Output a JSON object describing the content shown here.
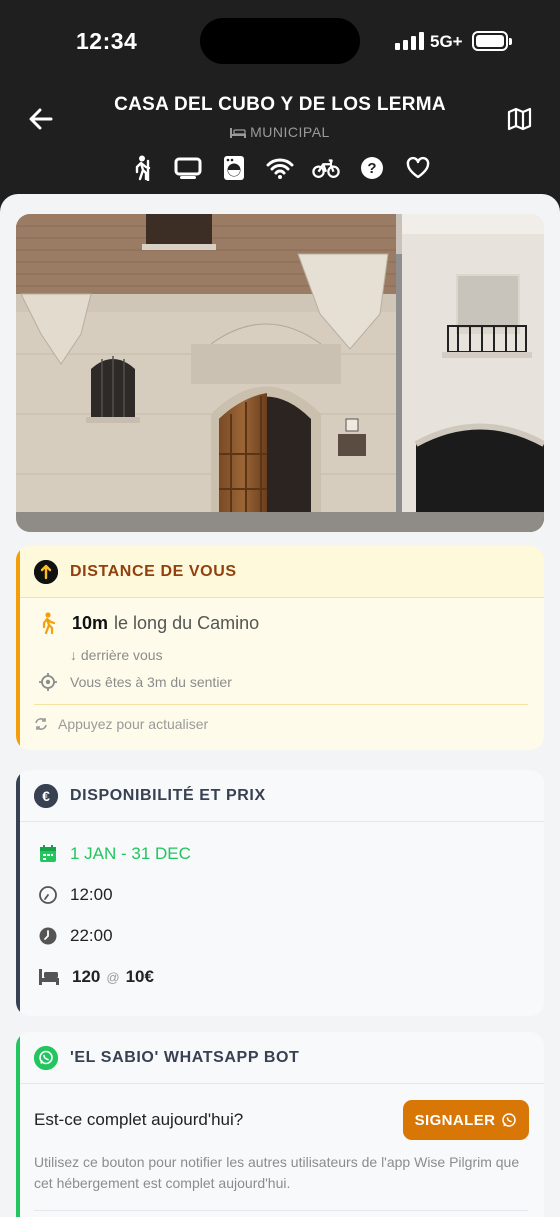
{
  "status_bar": {
    "time": "12:34",
    "network": "5G+"
  },
  "header": {
    "title": "CASA DEL CUBO Y DE LOS LERMA",
    "subtitle": "MUNICIPAL",
    "amenity_icons": [
      "walking-icon",
      "tv-icon",
      "washing-machine-icon",
      "wifi-icon",
      "bicycle-icon",
      "help-icon",
      "heart-icon"
    ]
  },
  "distance_card": {
    "title": "DISTANCE DE VOUS",
    "distance": "10m",
    "distance_suffix": "le long du Camino",
    "direction": "↓ derrière vous",
    "path_info": "Vous êtes à 3m du sentier",
    "refresh": "Appuyez pour actualiser",
    "accent": "#f59e0b"
  },
  "availability_card": {
    "title": "DISPONIBILITÉ ET PRIX",
    "dates": "1 JAN - 31 DEC",
    "open_time": "12:00",
    "close_time": "22:00",
    "beds": "120",
    "at": "@",
    "price": "10€",
    "accent": "#374151"
  },
  "whatsapp_card": {
    "title": "'EL SABIO' WHATSAPP BOT",
    "question": "Est-ce complet aujourd'hui?",
    "button_label": "SIGNALER",
    "description": "Utilisez ce bouton pour notifier les autres utilisateurs de l'app Wise Pilgrim que cet hébergement est complet aujourd'hui.",
    "accent": "#22c55e"
  }
}
